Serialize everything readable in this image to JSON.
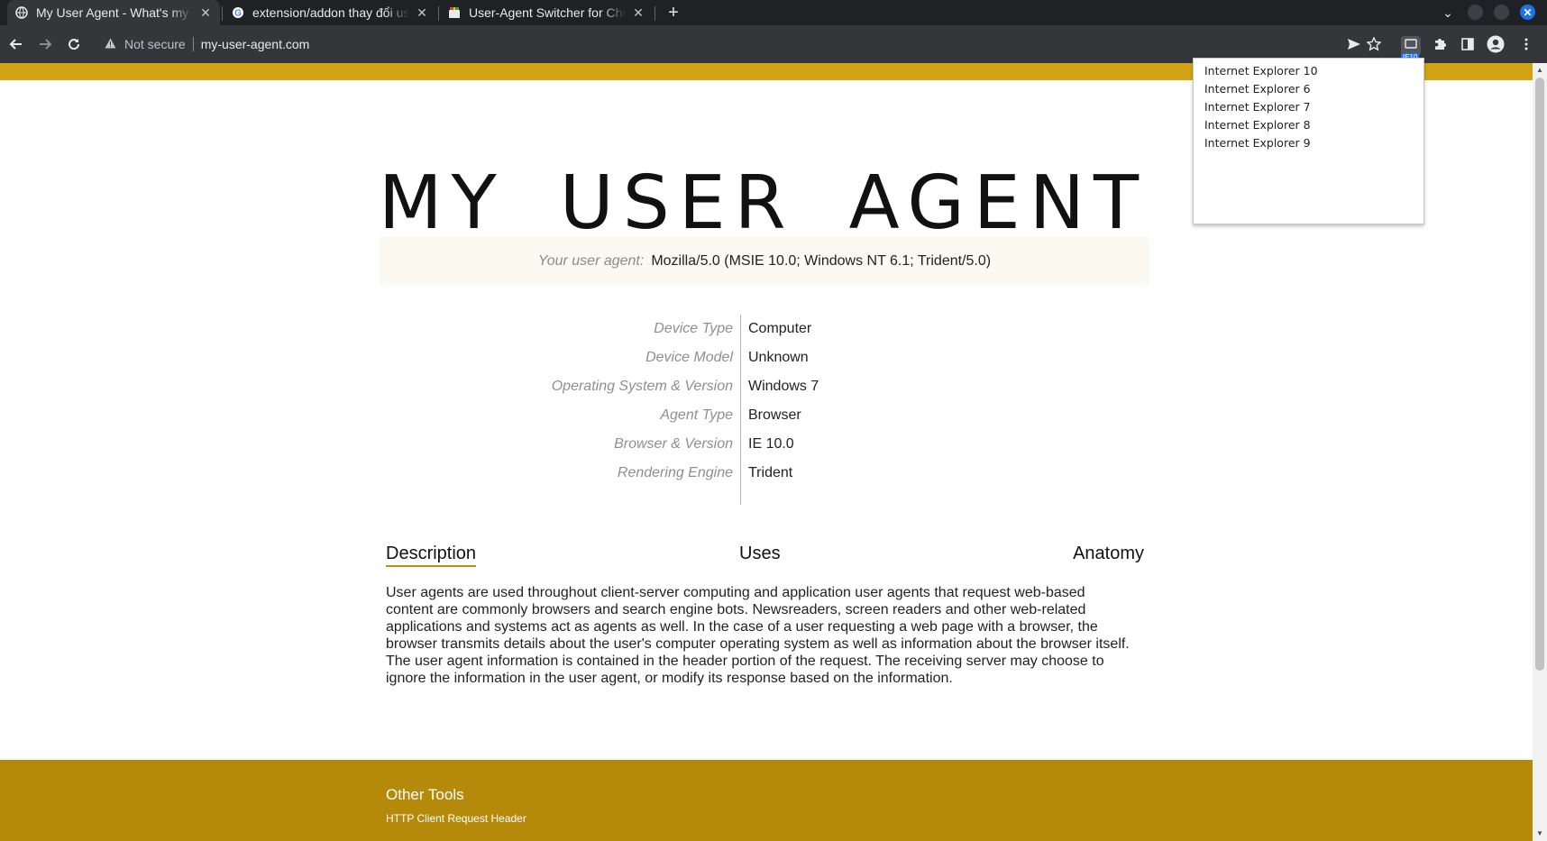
{
  "browser": {
    "tabs": [
      {
        "title": "My User Agent - What's my user agent?",
        "active": true
      },
      {
        "title": "extension/addon thay đổi user agent",
        "active": false
      },
      {
        "title": "User-Agent Switcher for Chrome",
        "active": false
      }
    ],
    "address_bar": {
      "security_label": "Not secure",
      "url": "my-user-agent.com"
    },
    "extension_badge": "IE10"
  },
  "popup": {
    "items": [
      "Internet Explorer 10",
      "Internet Explorer 6",
      "Internet Explorer 7",
      "Internet Explorer 8",
      "Internet Explorer 9"
    ]
  },
  "page": {
    "title": "MY USER AGENT",
    "ua_label": "Your user agent:",
    "ua_value": "Mozilla/5.0 (MSIE 10.0; Windows NT 6.1; Trident/5.0)",
    "details": [
      {
        "label": "Device Type",
        "value": "Computer"
      },
      {
        "label": "Device Model",
        "value": "Unknown"
      },
      {
        "label": "Operating System & Version",
        "value": "Windows 7"
      },
      {
        "label": "Agent Type",
        "value": "Browser"
      },
      {
        "label": "Browser & Version",
        "value": "IE 10.0"
      },
      {
        "label": "Rendering Engine",
        "value": "Trident"
      }
    ],
    "tabs": [
      "Description",
      "Uses",
      "Anatomy"
    ],
    "description": "User agents are used throughout client-server computing and application user agents that request web-based content are commonly browsers and search engine bots. Newsreaders, screen readers and other web-related applications and systems act as agents as well. In the case of a user requesting a web page with a browser, the browser transmits details about the user's computer operating system as well as information about the browser itself. The user agent information is contained in the header portion of the request. The receiving server may choose to ignore the information in the user agent, or modify its response based on the information.",
    "footer": {
      "title": "Other Tools",
      "link": "HTTP Client Request Header"
    }
  },
  "colors": {
    "top_stripe": "#d4a315",
    "footer": "#b58a0a",
    "ua_box": "#fbf9f0",
    "tab_underline": "#c98a1b"
  },
  "icons": [
    "globe-icon",
    "google-icon",
    "chrome-store-icon",
    "back-arrow-icon",
    "forward-arrow-icon",
    "reload-icon",
    "warning-icon",
    "send-icon",
    "star-icon",
    "puzzle-icon",
    "side-panel-icon",
    "profile-icon",
    "kebab-menu-icon"
  ]
}
